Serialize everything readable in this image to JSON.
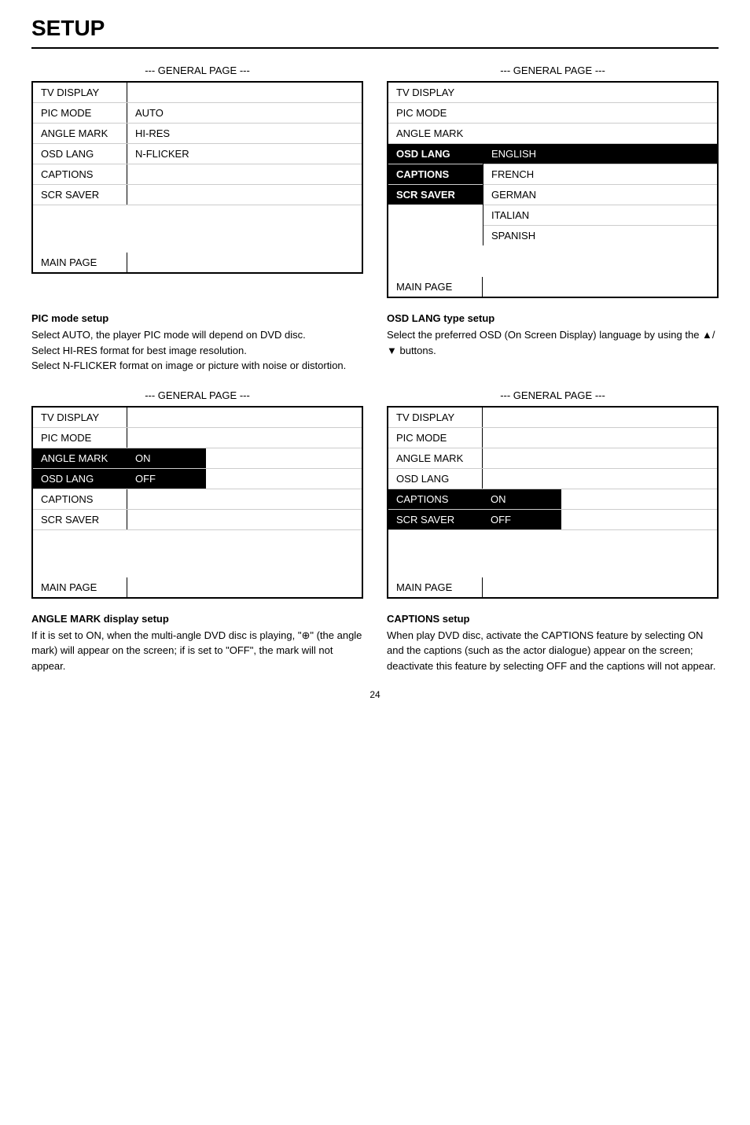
{
  "page": {
    "title": "SETUP",
    "number": "24"
  },
  "general_label": "--- GENERAL PAGE ---",
  "menus": {
    "top_left": {
      "rows": [
        "TV DISPLAY",
        "PIC MODE",
        "ANGLE MARK",
        "OSD LANG",
        "CAPTIONS",
        "SCR SAVER"
      ],
      "values": {
        "PIC MODE": "AUTO",
        "ANGLE MARK": "HI-RES",
        "OSD LANG": "N-FLICKER"
      },
      "footer": "MAIN PAGE"
    },
    "top_right": {
      "rows": [
        "TV DISPLAY",
        "PIC MODE",
        "ANGLE MARK",
        "OSD LANG",
        "CAPTIONS",
        "SCR SAVER"
      ],
      "footer": "MAIN PAGE",
      "lang_options": [
        "ENGLISH",
        "FRENCH",
        "GERMAN",
        "ITALIAN",
        "SPANISH"
      ],
      "active_lang": "ENGLISH",
      "active_row": "OSD LANG"
    },
    "bottom_left": {
      "rows": [
        "TV DISPLAY",
        "PIC MODE",
        "ANGLE MARK",
        "OSD LANG",
        "CAPTIONS",
        "SCR SAVER"
      ],
      "values": {
        "ANGLE MARK": "ON",
        "OSD LANG": "OFF"
      },
      "footer": "MAIN PAGE"
    },
    "bottom_right": {
      "rows": [
        "TV DISPLAY",
        "PIC MODE",
        "ANGLE MARK",
        "OSD LANG",
        "CAPTIONS",
        "SCR SAVER"
      ],
      "values": {
        "CAPTIONS": "ON",
        "SCR SAVER": "OFF"
      },
      "footer": "MAIN PAGE"
    }
  },
  "descriptions": {
    "pic_mode": {
      "title": "PIC mode setup",
      "text": "Select AUTO, the player PIC mode will depend on DVD disc.\nSelect HI-RES format for best image resolution.\nSelect N-FLICKER format on image or picture with noise or distortion."
    },
    "osd_lang": {
      "title": "OSD LANG type setup",
      "text": "Select the preferred OSD (On Screen Display) language by using the ▲/▼ buttons."
    },
    "angle_mark": {
      "title": "ANGLE MARK display setup",
      "text": "If it is set to ON, when the multi-angle DVD disc is playing, \"⊕\" (the angle mark) will appear on the screen; if is set to \"OFF\", the mark will not appear."
    },
    "captions": {
      "title": "CAPTIONS setup",
      "text": "When play DVD disc, activate the CAPTIONS feature by selecting ON and the captions (such as the actor dialogue) appear on the screen; deactivate this feature by selecting OFF and the captions will not appear."
    }
  }
}
